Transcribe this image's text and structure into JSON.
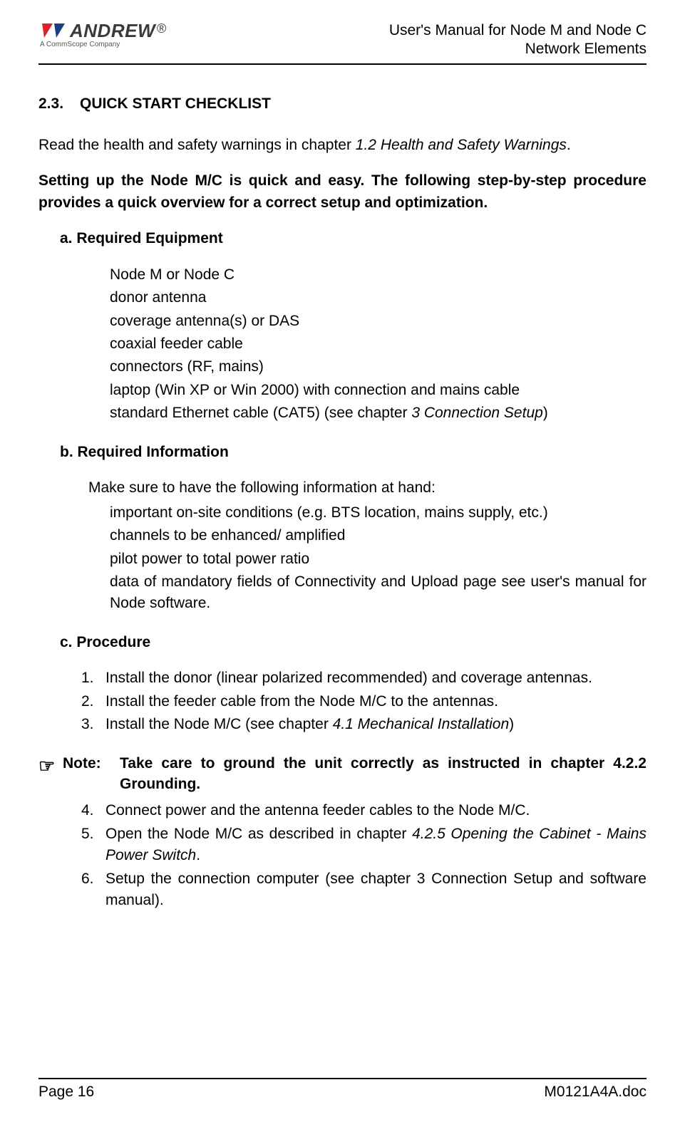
{
  "header": {
    "logo_name": "ANDREW",
    "logo_sub": "A CommScope Company",
    "title_line1": "User's Manual for Node M and Node C",
    "title_line2": "Network Elements"
  },
  "section": {
    "number": "2.3.",
    "title": "QUICK START CHECKLIST"
  },
  "intro": {
    "pre": "Read the health and safety warnings in chapter ",
    "ref": "1.2 Health and Safety Warnings",
    "post": "."
  },
  "lead": "Setting up the Node M/C is quick and easy. The following step-by-step procedure provides a quick overview for a correct setup and optimization.",
  "sub_a": "a.  Required Equipment",
  "equipment": [
    "Node M or Node C",
    "donor antenna",
    "coverage antenna(s) or DAS",
    "coaxial feeder cable",
    "connectors (RF, mains)",
    "laptop (Win XP or Win 2000) with connection and mains cable"
  ],
  "equipment_last": {
    "pre": " standard Ethernet cable (CAT5) (see chapter ",
    "ref": "3 Connection Setup",
    "post": ")"
  },
  "sub_b": "b.  Required Information",
  "info_intro": "Make sure to have the following information at hand:",
  "info": [
    "important on-site conditions (e.g. BTS location, mains supply, etc.)",
    "channels to be enhanced/ amplified",
    "pilot power to total power ratio",
    "data of mandatory fields of Connectivity and Upload page see user's manual for Node software."
  ],
  "sub_c": "c.  Procedure",
  "proc1": {
    "n": "1.",
    "t": "Install the donor (linear polarized recommended) and coverage antennas."
  },
  "proc2": {
    "n": "2.",
    "t": "Install the feeder cable from the Node M/C to the antennas."
  },
  "proc3": {
    "n": "3.",
    "pre": "Install the Node M/C (see chapter ",
    "ref": "4.1 Mechanical Installation",
    "post": ")"
  },
  "note": {
    "icon": "☞",
    "label": "Note:",
    "text": "Take care to ground the unit correctly as instructed in chapter 4.2.2 Grounding."
  },
  "proc4": {
    "n": "4.",
    "t": "Connect power and the antenna feeder cables to the Node M/C."
  },
  "proc5": {
    "n": "5.",
    "pre": "Open the Node M/C as described in chapter ",
    "ref": "4.2.5 Opening the Cabinet - Mains Power Switch",
    "post": "."
  },
  "proc6": {
    "n": "6.",
    "t": "Setup the connection computer (see chapter 3 Connection Setup and software manual)."
  },
  "footer": {
    "left": "Page 16",
    "right": "M0121A4A.doc"
  }
}
